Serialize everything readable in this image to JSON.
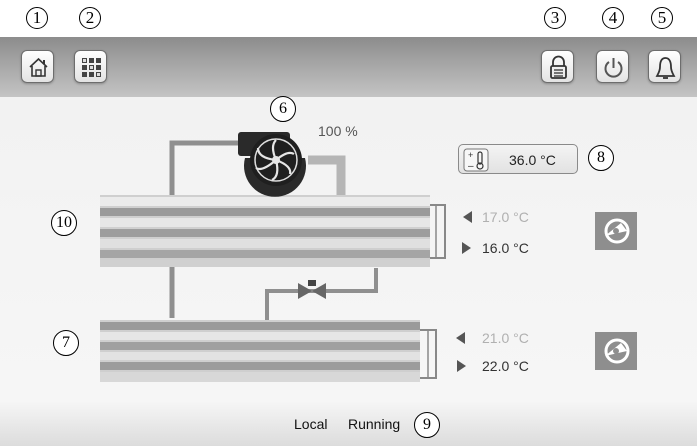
{
  "callouts": {
    "c1": "1",
    "c2": "2",
    "c3": "3",
    "c4": "4",
    "c5": "5",
    "c6": "6",
    "c7": "7",
    "c8": "8",
    "c9": "9",
    "c10": "10"
  },
  "toolbar": {
    "home": "home-icon",
    "menu": "menu-grid-icon",
    "lock": "lock-icon",
    "power": "power-icon",
    "alarm": "bell-icon"
  },
  "fan": {
    "percent_label": "100 %",
    "percent": 100
  },
  "setpoint": {
    "value": "36.0 °C"
  },
  "upper_exchanger": {
    "in_temp": "17.0 °C",
    "out_temp": "16.0 °C"
  },
  "lower_exchanger": {
    "in_temp": "21.0 °C",
    "out_temp": "22.0 °C"
  },
  "status": {
    "mode": "Local",
    "state": "Running"
  },
  "colors": {
    "pipe": "#a3a3a3",
    "fin_dark": "#7a7a7a",
    "fin_light": "#dcdcdc",
    "muted_text": "#b0b0b0"
  }
}
